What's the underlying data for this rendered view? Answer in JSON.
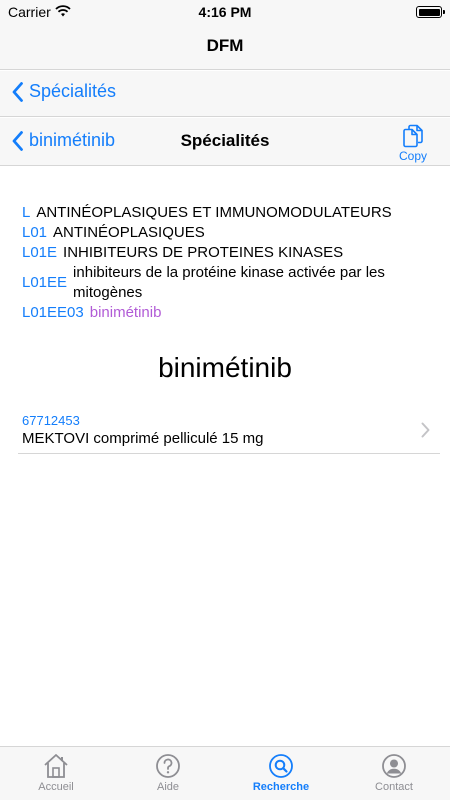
{
  "status_bar": {
    "carrier": "Carrier",
    "time": "4:16 PM"
  },
  "header": {
    "title": "DFM"
  },
  "nav1": {
    "back_label": "Spécialités"
  },
  "nav2": {
    "back_label": "binimétinib",
    "title": "Spécialités",
    "copy_label": "Copy"
  },
  "atc": [
    {
      "code": "L",
      "label": "ANTINÉOPLASIQUES ET IMMUNOMODULATEURS"
    },
    {
      "code": "L01",
      "label": "ANTINÉOPLASIQUES"
    },
    {
      "code": "L01E",
      "label": "INHIBITEURS DE PROTEINES KINASES"
    },
    {
      "code": "L01EE",
      "label": "inhibiteurs de la protéine kinase activée par les mitogènes"
    },
    {
      "code": "L01EE03",
      "label": "binimétinib"
    }
  ],
  "drug": {
    "title": "binimétinib"
  },
  "products": [
    {
      "code": "67712453",
      "name": "MEKTOVI comprimé pelliculé 15 mg"
    }
  ],
  "tabs": [
    {
      "label": "Accueil",
      "icon": "home-icon"
    },
    {
      "label": "Aide",
      "icon": "help-icon"
    },
    {
      "label": "Recherche",
      "icon": "search-icon",
      "active": true
    },
    {
      "label": "Contact",
      "icon": "contact-icon"
    }
  ],
  "colors": {
    "accent": "#147efb",
    "highlight": "#b15bd6",
    "inactive": "#8e8e93",
    "bar_bg": "#f7f7f7"
  }
}
